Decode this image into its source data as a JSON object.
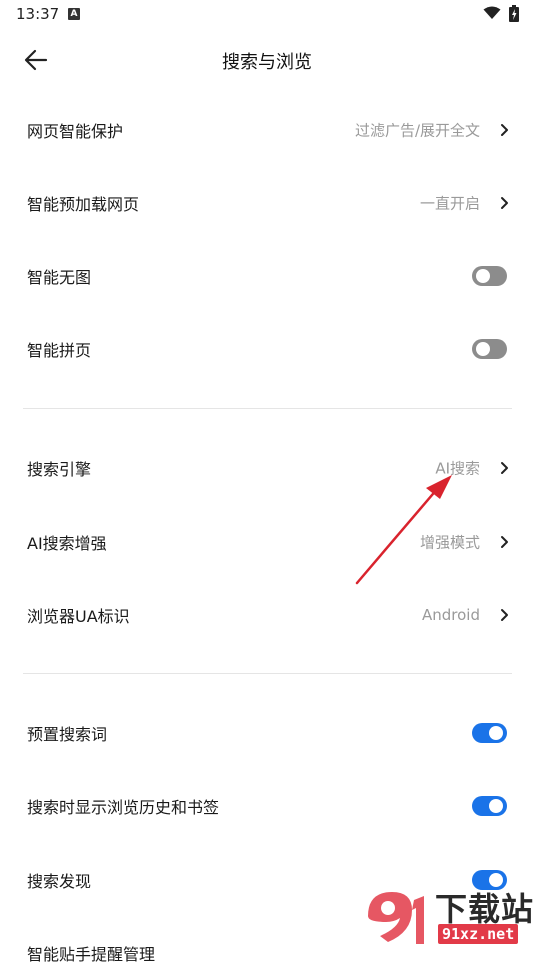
{
  "status_bar": {
    "time": "13:37",
    "notification_icon": "A"
  },
  "header": {
    "title": "搜索与浏览"
  },
  "section1": [
    {
      "label": "网页智能保护",
      "value": "过滤广告/展开全文",
      "type": "nav"
    },
    {
      "label": "智能预加载网页",
      "value": "一直开启",
      "type": "nav"
    },
    {
      "label": "智能无图",
      "type": "toggle",
      "state": "off"
    },
    {
      "label": "智能拼页",
      "type": "toggle",
      "state": "off"
    }
  ],
  "section2": [
    {
      "label": "搜索引擎",
      "value": "AI搜索",
      "type": "nav"
    },
    {
      "label": "AI搜索增强",
      "value": "增强模式",
      "type": "nav"
    },
    {
      "label": "浏览器UA标识",
      "value": "Android",
      "type": "nav"
    }
  ],
  "section3": [
    {
      "label": "预置搜索词",
      "type": "toggle",
      "state": "on"
    },
    {
      "label": "搜索时显示浏览历史和书签",
      "type": "toggle",
      "state": "on"
    },
    {
      "label": "搜索发现",
      "type": "toggle",
      "state": "on"
    },
    {
      "label": "智能贴手提醒管理",
      "type": "nav"
    }
  ],
  "watermark": {
    "name": "下载站",
    "url": "91xz.net"
  },
  "colors": {
    "accent": "#1a73e8",
    "toggle_off": "#8c8c8c",
    "annotation_arrow": "#d9232d",
    "watermark_red": "#e23a48"
  },
  "icons": {
    "back": "arrow-left-icon",
    "chevron": "chevron-right-icon",
    "wifi": "wifi-icon",
    "battery": "battery-icon"
  }
}
